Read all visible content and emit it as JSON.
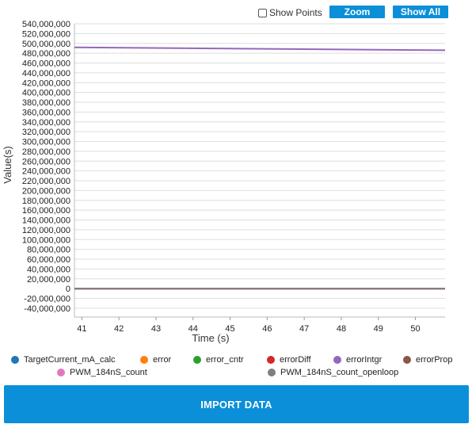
{
  "toolbar": {
    "show_points_label": "Show Points",
    "zoom_label": "Zoom",
    "show_all_label": "Show All"
  },
  "colors": {
    "accent": "#0a8fd8"
  },
  "chart_data": {
    "type": "line",
    "xlabel": "Time (s)",
    "ylabel": "Value(s)",
    "xlim": [
      40.8,
      50.8
    ],
    "ylim": [
      -45000000,
      540000000
    ],
    "x_ticks": [
      41,
      42,
      43,
      44,
      45,
      46,
      47,
      48,
      49,
      50
    ],
    "y_ticks": [
      540000000,
      520000000,
      500000000,
      480000000,
      460000000,
      440000000,
      420000000,
      400000000,
      380000000,
      360000000,
      340000000,
      320000000,
      300000000,
      280000000,
      260000000,
      240000000,
      220000000,
      200000000,
      180000000,
      160000000,
      140000000,
      120000000,
      100000000,
      80000000,
      60000000,
      40000000,
      20000000,
      0,
      -20000000,
      -40000000
    ],
    "y_tick_labels": [
      "540,000,000",
      "520,000,000",
      "500,000,000",
      "480,000,000",
      "460,000,000",
      "440,000,000",
      "420,000,000",
      "400,000,000",
      "380,000,000",
      "360,000,000",
      "340,000,000",
      "320,000,000",
      "300,000,000",
      "280,000,000",
      "260,000,000",
      "240,000,000",
      "220,000,000",
      "200,000,000",
      "180,000,000",
      "160,000,000",
      "140,000,000",
      "120,000,000",
      "100,000,000",
      "80,000,000",
      "60,000,000",
      "40,000,000",
      "20,000,000",
      "0",
      "-20,000,000",
      "-40,000,000"
    ],
    "grid": true,
    "legend_position": "bottom",
    "x": [
      40.8,
      50.8
    ],
    "series": [
      {
        "name": "TargetCurrent_mA_calc",
        "color": "#1f77b4",
        "values": [
          0,
          0
        ]
      },
      {
        "name": "error",
        "color": "#ff7f0e",
        "values": [
          0,
          0
        ]
      },
      {
        "name": "error_cntr",
        "color": "#2ca02c",
        "values": [
          0,
          0
        ]
      },
      {
        "name": "errorDiff",
        "color": "#d62728",
        "values": [
          0,
          0
        ]
      },
      {
        "name": "errorIntgr",
        "color": "#9467bd",
        "values": [
          492000000,
          486000000
        ]
      },
      {
        "name": "errorProp",
        "color": "#8c564b",
        "values": [
          0,
          0
        ]
      },
      {
        "name": "PWM_184nS_count",
        "color": "#e377c2",
        "values": [
          0,
          0
        ]
      },
      {
        "name": "PWM_184nS_count_openloop",
        "color": "#7f7f7f",
        "values": [
          0,
          0
        ]
      }
    ]
  },
  "import_label": "IMPORT DATA"
}
